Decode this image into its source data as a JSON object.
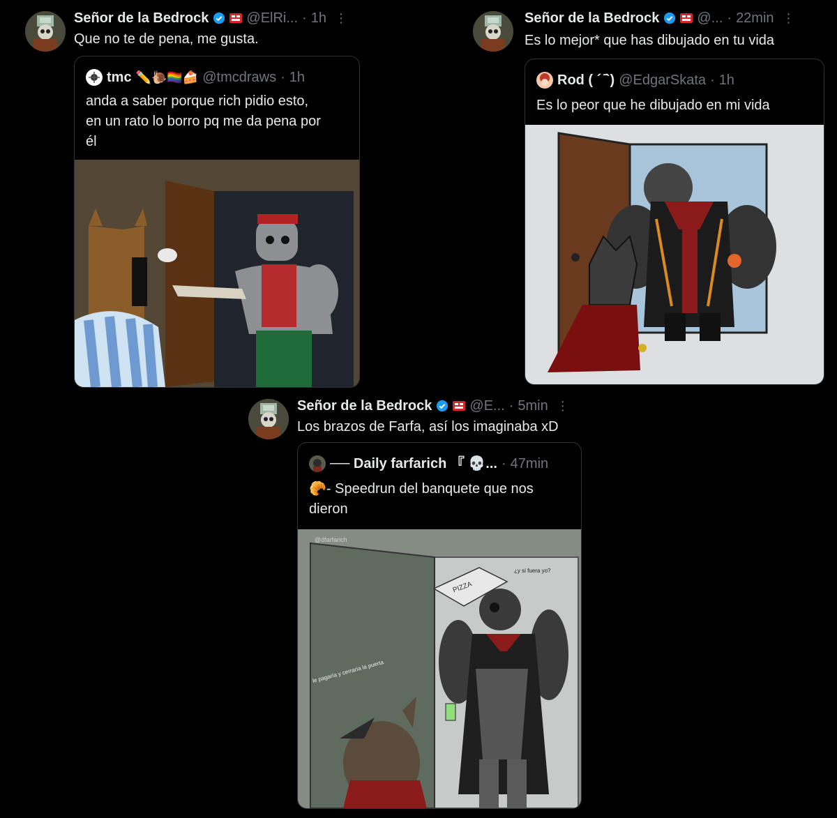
{
  "tweets": [
    {
      "author": "Señor de la Bedrock",
      "handle": "@ElRi...",
      "time": "1h",
      "text": "Que no te de pena, me gusta.",
      "quote": {
        "author": "tmc",
        "author_emojis": "✏️🐌🏳️‍🌈🍰",
        "handle": "@tmcdraws",
        "time": "1h",
        "text_lines": [
          "anda a saber porque rich pidio esto,",
          "en un rato lo borro pq me da pena por",
          "él"
        ]
      }
    },
    {
      "author": "Señor de la Bedrock",
      "handle": "@...",
      "time": "22min",
      "text": "Es lo mejor* que has dibujado en tu vida",
      "quote": {
        "author": "Rod ( ´ ̄`)",
        "handle": "@EdgarSkata",
        "time": "1h",
        "text_lines": [
          "Es lo peor que he dibujado en mi vida"
        ]
      }
    },
    {
      "author": "Señor de la Bedrock",
      "handle": "@E...",
      "time": "5min",
      "text": "Los brazos de Farfa, así los imaginaba xD",
      "quote": {
        "author": "── Daily farfarich 『 💀...",
        "handle": "",
        "time": "47min",
        "text_lines": [
          "🥐- Speedrun del banquete que nos",
          "dieron"
        ],
        "drawing_texts": [
          "@dfarfarich",
          "PIZZA",
          "¿y si fuera yo?",
          "le pagaría y cerraría la puerta"
        ]
      }
    }
  ],
  "ui": {
    "dot": "·",
    "more": "⋮"
  },
  "colors": {
    "verified": "#1d9bf0",
    "muted": "#71767b",
    "border": "#2f3336",
    "text": "#e7e9ea"
  },
  "icons": [
    "verified-badge-icon",
    "affiliate-badge-icon",
    "more-icon"
  ]
}
